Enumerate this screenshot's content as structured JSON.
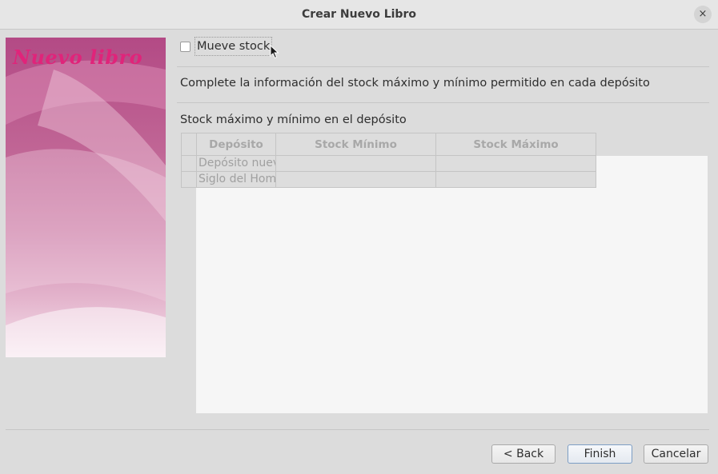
{
  "window": {
    "title": "Crear Nuevo Libro",
    "close_glyph": "×"
  },
  "side_panel": {
    "title": "Nuevo libro"
  },
  "checkbox": {
    "label": "Mueve stock",
    "checked": false
  },
  "info_text": "Complete la información del stock máximo y mínimo permitido en cada depósito",
  "section_label": "Stock máximo y mínimo en el depósito",
  "table": {
    "columns": [
      "Depósito",
      "Stock Mínimo",
      "Stock Máximo"
    ],
    "rows": [
      {
        "deposito": "Depósito nuev",
        "minimo": "",
        "maximo": ""
      },
      {
        "deposito": "Siglo del Hom",
        "minimo": "",
        "maximo": ""
      }
    ]
  },
  "buttons": {
    "back": "< Back",
    "finish": "Finish",
    "cancel": "Cancelar"
  },
  "colors": {
    "accent_pink": "#e0247a",
    "window_bg": "#dcdcdc"
  }
}
